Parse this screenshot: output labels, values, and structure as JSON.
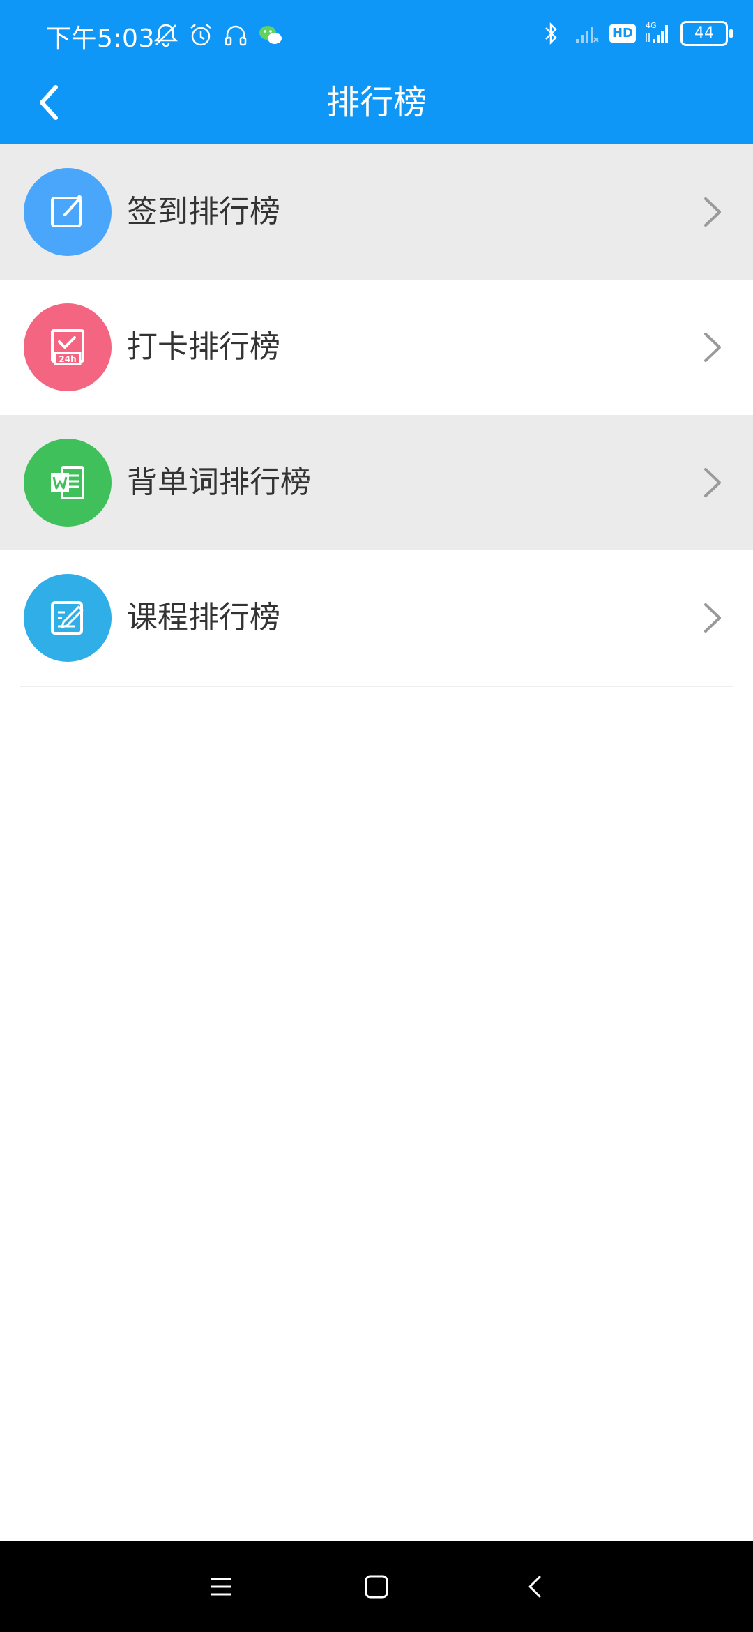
{
  "status_bar": {
    "time": "下午5:03",
    "battery": "44",
    "network_type": "4G",
    "hd_label": "HD"
  },
  "header": {
    "title": "排行榜"
  },
  "colors": {
    "header_blue": "#0e97f6",
    "icon_blue": "#4aa6fa",
    "icon_pink": "#f36580",
    "icon_green": "#3fc05a",
    "icon_cyan": "#30aee8"
  },
  "list": {
    "items": [
      {
        "label": "签到排行榜",
        "icon": "checkin-edit-icon"
      },
      {
        "label": "打卡排行榜",
        "icon": "punch-24h-icon"
      },
      {
        "label": "背单词排行榜",
        "icon": "word-document-icon"
      },
      {
        "label": "课程排行榜",
        "icon": "course-edit-icon"
      }
    ]
  },
  "icons": {
    "chevron": "chevron-right-icon",
    "back": "back-arrow-icon",
    "nav_menu": "menu-icon",
    "nav_home": "home-square-icon",
    "nav_back": "back-triangle-icon"
  }
}
